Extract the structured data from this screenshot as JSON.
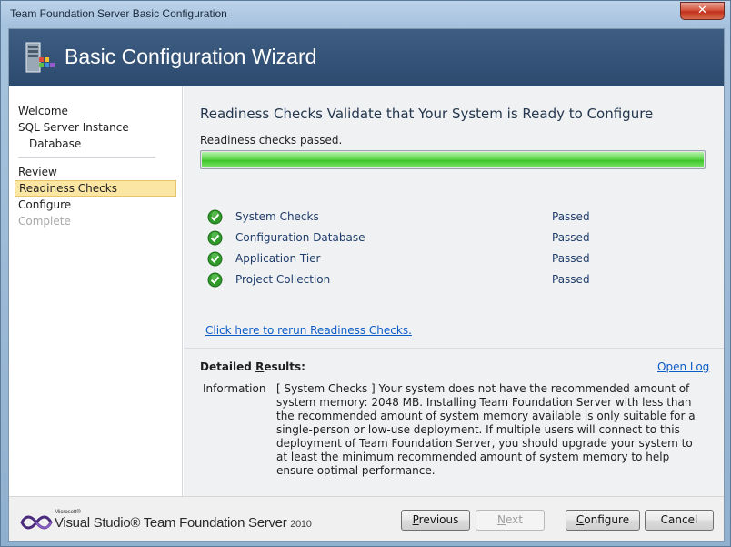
{
  "window": {
    "title": "Team Foundation Server Basic Configuration",
    "close_label": "✕"
  },
  "banner": {
    "title": "Basic Configuration Wizard"
  },
  "nav": {
    "items": [
      {
        "label": "Welcome",
        "state": "normal"
      },
      {
        "label": "SQL Server Instance",
        "state": "normal"
      },
      {
        "label": "Database",
        "state": "normal"
      },
      {
        "label": "Review",
        "state": "normal"
      },
      {
        "label": "Readiness Checks",
        "state": "selected"
      },
      {
        "label": "Configure",
        "state": "normal"
      },
      {
        "label": "Complete",
        "state": "disabled"
      }
    ]
  },
  "main": {
    "heading": "Readiness Checks Validate that Your System is Ready to Configure",
    "status_text": "Readiness checks passed.",
    "progress_fraction": 1.0,
    "checks": [
      {
        "label": "System Checks",
        "status": "Passed"
      },
      {
        "label": "Configuration Database",
        "status": "Passed"
      },
      {
        "label": "Application Tier",
        "status": "Passed"
      },
      {
        "label": "Project Collection",
        "status": "Passed"
      }
    ],
    "rerun_link": "Click here to rerun Readiness Checks.",
    "results": {
      "title_prefix": "Detailed ",
      "title_accel": "R",
      "title_suffix": "esults:",
      "open_log": "Open Log",
      "info_label": "Information",
      "info_text": "[ System Checks ] Your system does not have the recommended amount of system memory: 2048 MB. Installing Team Foundation Server with less than the recommended amount of system memory available is only suitable for a single-person or low-use deployment. If multiple users will connect to this deployment of Team Foundation Server, you should upgrade your system to at least the minimum recommended amount of system memory to help ensure optimal performance."
    }
  },
  "footer": {
    "logo_ms": "Microsoft®",
    "logo_text": "Visual Studio® Team Foundation Server",
    "logo_year": "2010",
    "buttons": {
      "previous_accel": "P",
      "previous_rest": "revious",
      "next_accel": "N",
      "next_rest": "ext",
      "configure_prefix": "",
      "configure_accel": "C",
      "configure_rest": "onfigure",
      "cancel": "Cancel"
    }
  },
  "colors": {
    "banner": "#2c4a6e",
    "selected_nav": "#fbe6a4",
    "progress": "#3ec52a",
    "link": "#0b5cc7",
    "check_green": "#2f9a2a"
  }
}
